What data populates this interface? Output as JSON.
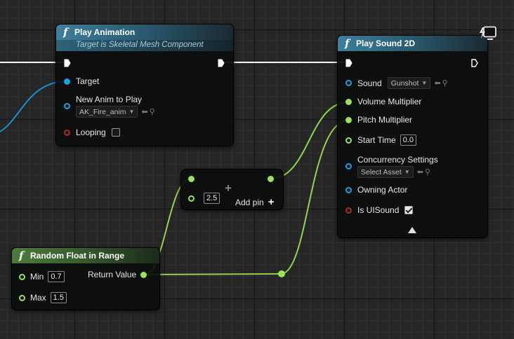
{
  "play_animation": {
    "title": "Play Animation",
    "subtitle": "Target is Skeletal Mesh Component",
    "pins": {
      "target": "Target",
      "new_anim_label": "New Anim to Play",
      "new_anim_value": "AK_Fire_anim",
      "looping": "Looping"
    },
    "looping_checked": false
  },
  "play_sound_2d": {
    "title": "Play Sound 2D",
    "pins": {
      "sound": "Sound",
      "sound_value": "Gunshot",
      "volume_multiplier": "Volume Multiplier",
      "pitch_multiplier": "Pitch Multiplier",
      "start_time": "Start Time",
      "start_time_value": "0.0",
      "concurrency_settings": "Concurrency Settings",
      "concurrency_value": "Select Asset",
      "owning_actor": "Owning Actor",
      "is_ui_sound": "Is UISound"
    },
    "is_ui_sound_checked": true
  },
  "add_node": {
    "value": "2.5",
    "add_pin_label": "Add pin"
  },
  "random_float": {
    "title": "Random Float in Range",
    "pins": {
      "min": "Min",
      "min_value": "0.7",
      "max": "Max",
      "max_value": "1.5",
      "return_value": "Return Value"
    }
  },
  "colors": {
    "exec_wire": "#ffffff",
    "object_pin": "#1aa0e6",
    "float_pin": "#9be35b",
    "bool_pin": "#b5262b",
    "function_header": "#3d7f9d",
    "pure_function_header": "#4c7b3c"
  },
  "icons": {
    "function": "function-f-icon",
    "client_only": "monitor-lightning-icon",
    "browse": "browse-arrow-icon",
    "find": "magnifier-icon",
    "add": "plus-icon",
    "expand": "triangle-up-icon"
  }
}
